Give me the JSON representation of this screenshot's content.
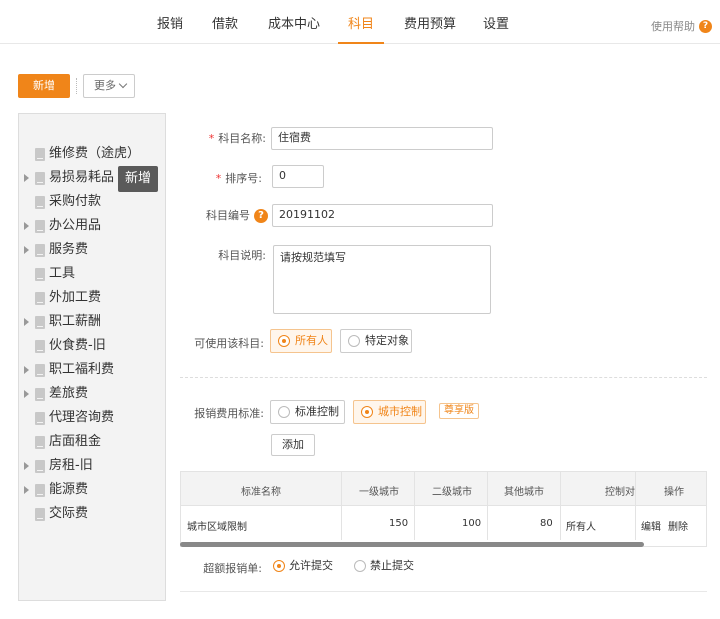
{
  "nav": {
    "tabs": [
      {
        "label": "报销"
      },
      {
        "label": "借款"
      },
      {
        "label": "成本中心"
      },
      {
        "label": "科目"
      },
      {
        "label": "费用预算"
      },
      {
        "label": "设置"
      }
    ],
    "active_index": 3,
    "help_label": "使用帮助",
    "help_icon_glyph": "?"
  },
  "toolbar": {
    "new_label": "新增",
    "more_label": "更多"
  },
  "tree": {
    "items": [
      {
        "label": "维修费（途虎）",
        "expandable": false
      },
      {
        "label": "易损易耗品",
        "expandable": true
      },
      {
        "label": "采购付款",
        "expandable": false
      },
      {
        "label": "办公用品",
        "expandable": true
      },
      {
        "label": "服务费",
        "expandable": true
      },
      {
        "label": "工具",
        "expandable": false
      },
      {
        "label": "外加工费",
        "expandable": false
      },
      {
        "label": "职工薪酬",
        "expandable": true
      },
      {
        "label": "伙食费-旧",
        "expandable": false
      },
      {
        "label": "职工福利费",
        "expandable": true
      },
      {
        "label": "差旅费",
        "expandable": true
      },
      {
        "label": "代理咨询费",
        "expandable": false
      },
      {
        "label": "店面租金",
        "expandable": false
      },
      {
        "label": "房租-旧",
        "expandable": true
      },
      {
        "label": "能源费",
        "expandable": true
      },
      {
        "label": "交际费",
        "expandable": false
      }
    ],
    "tooltip": "新增"
  },
  "form": {
    "req_mark": "*",
    "name_label": "科目名称:",
    "name_value": "住宿费",
    "sort_label": "排序号:",
    "sort_value": "0",
    "code_label": "科目编号",
    "code_help_glyph": "?",
    "code_value": "20191102",
    "desc_label": "科目说明:",
    "desc_value": "请按规范填写",
    "usable_label": "可使用该科目:",
    "usable_options": [
      "所有人",
      "特定对象"
    ],
    "standard_label": "报销费用标准:",
    "standard_options": [
      "标准控制",
      "城市控制"
    ],
    "badge": "尊享版",
    "add_label": "添加",
    "over_label": "超额报销单:",
    "over_options": [
      "允许提交",
      "禁止提交"
    ]
  },
  "table": {
    "headers": [
      "标准名称",
      "一级城市",
      "二级城市",
      "其他城市",
      "控制对",
      "操作"
    ],
    "rows": [
      {
        "name": "城市区域限制",
        "c1": "150",
        "c2": "100",
        "c3": "80",
        "target": "所有人",
        "edit": "编辑",
        "delete": "删除"
      }
    ]
  },
  "colors": {
    "accent": "#f08519"
  }
}
